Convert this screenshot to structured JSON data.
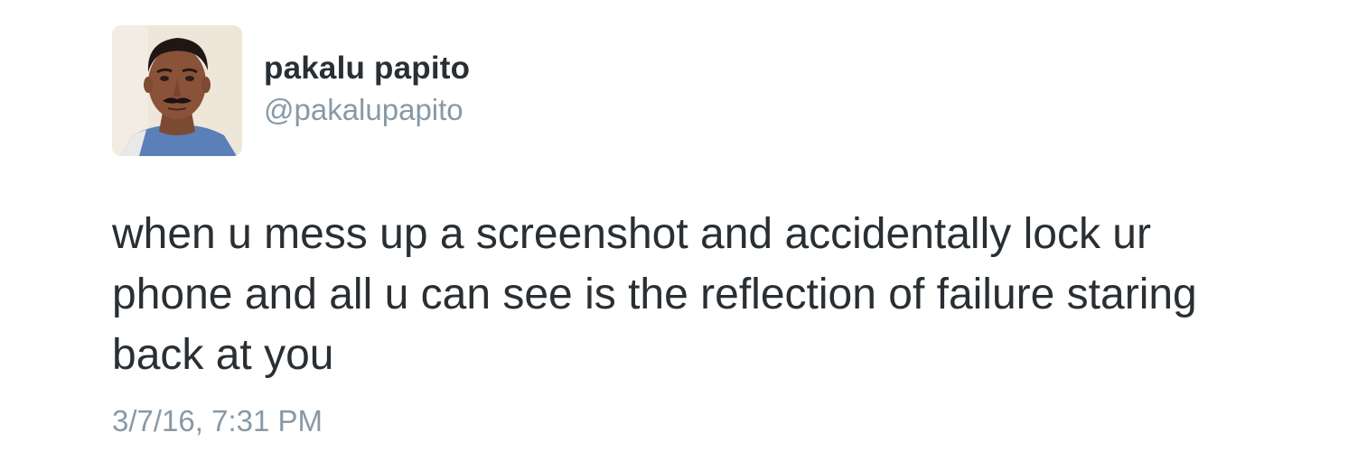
{
  "user": {
    "display_name": "pakalu papito",
    "handle": "@pakalupapito"
  },
  "tweet": {
    "line1": "when u mess up a screenshot and accidentally lock ur",
    "line2": "phone and all u can see is the reflection of failure staring",
    "line3": "back at you",
    "timestamp": "3/7/16, 7:31 PM"
  },
  "colors": {
    "name_text": "#292f33",
    "muted_text": "#8899a6",
    "background": "#ffffff"
  }
}
